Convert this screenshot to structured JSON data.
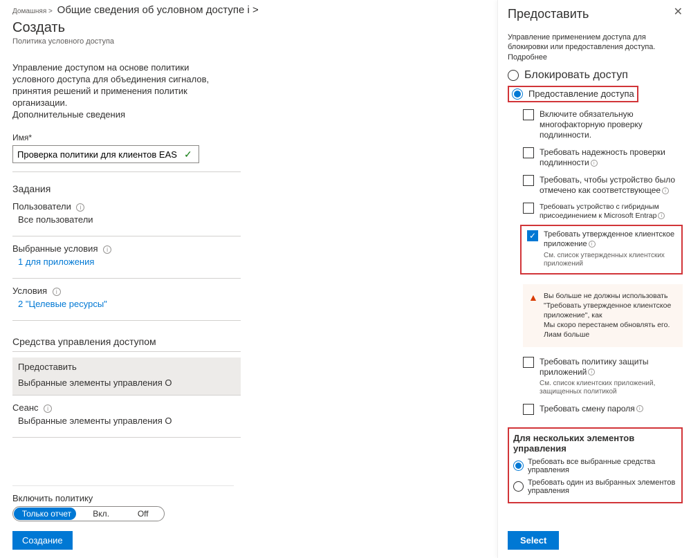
{
  "breadcrumb": {
    "home": "Домашняя >",
    "current": "Общие сведения об условном доступе i >"
  },
  "page": {
    "title": "Создать",
    "subtitle": "Политика условного доступа",
    "intro_l1": "Управление доступом на основе политики",
    "intro_l2": "условного доступа для объединения сигналов,",
    "intro_l3": "принятия решений и применения политик организации.",
    "intro_link": "Дополнительные сведения"
  },
  "name": {
    "label": "Имя*",
    "value": "Проверка политики для клиентов EAS"
  },
  "assignments": {
    "heading": "Задания",
    "users_label": "Пользователи",
    "users_value": "Все пользователи",
    "conditions_label": "Выбранные условия",
    "conditions_value": "1 для приложения",
    "cond2_label": "Условия",
    "cond2_value": "2 \"Целевые ресурсы\""
  },
  "access_controls": {
    "heading": "Средства управления доступом",
    "grant_label": "Предоставить",
    "grant_value": "Выбранные элементы управления O",
    "session_label": "Сеанс",
    "session_value": "Выбранные элементы управления O"
  },
  "enable": {
    "label": "Включить политику",
    "opt1": "Только отчет",
    "opt2": "Вкл.",
    "opt3": "Off"
  },
  "create_button": "Создание",
  "blade": {
    "title": "Предоставить",
    "desc": "Управление применением доступа для блокировки или предоставления доступа.",
    "more": "Подробнее",
    "block": "Блокировать доступ",
    "grant": "Предоставление доступа",
    "cb_mfa": "Включите обязательную многофакторную проверку подлинности.",
    "cb_authstr": "Требовать надежность проверки подлинности",
    "cb_compliant": "Требовать, чтобы устройство было отмечено как соответствующее",
    "cb_hybrid": "Требовать устройство с гибридным присоединением к Microsoft Entrap",
    "cb_approved": "Требовать утвержденное клиентское приложение",
    "cb_approved_sub": "См. список утвержденных клиентских приложений",
    "warn_l1": "Вы больше не должны использовать \"Требовать утвержденное клиентское приложение\", как",
    "warn_l2": "Мы скоро перестанем обновлять его.",
    "warn_l3": "Лиам больше",
    "cb_appprot": "Требовать политику защиты приложений",
    "cb_appprot_sub": "См. список клиентских приложений, защищенных политикой",
    "cb_pwchange": "Требовать смену пароля",
    "multi_title": "Для нескольких элементов управления",
    "multi_all": "Требовать все выбранные средства управления",
    "multi_one": "Требовать один из выбранных элементов управления",
    "select": "Select"
  }
}
